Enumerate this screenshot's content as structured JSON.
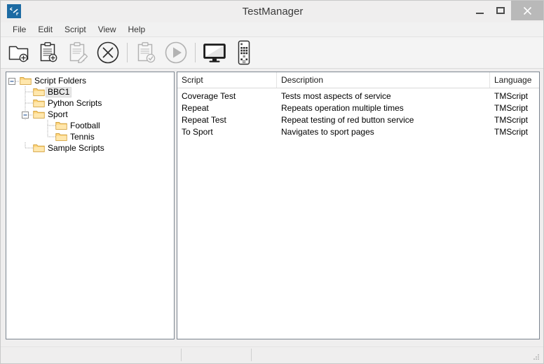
{
  "window": {
    "title": "TestManager",
    "app_icon": "app-icon",
    "controls": {
      "minimize": "minimize-button",
      "maximize": "maximize-button",
      "close": "close-button"
    }
  },
  "menubar": {
    "items": [
      {
        "label": "File"
      },
      {
        "label": "Edit"
      },
      {
        "label": "Script"
      },
      {
        "label": "View"
      },
      {
        "label": "Help"
      }
    ]
  },
  "toolbar": {
    "buttons": [
      {
        "icon": "new-folder-icon",
        "enabled": true
      },
      {
        "icon": "new-script-icon",
        "enabled": true
      },
      {
        "icon": "edit-script-icon",
        "enabled": false
      },
      {
        "icon": "delete-icon",
        "enabled": true
      },
      {
        "separator": true
      },
      {
        "icon": "validate-script-icon",
        "enabled": false
      },
      {
        "icon": "run-script-icon",
        "enabled": false
      },
      {
        "separator": true
      },
      {
        "icon": "television-icon",
        "enabled": true
      },
      {
        "icon": "remote-control-icon",
        "enabled": true
      }
    ]
  },
  "tree": {
    "nodes": [
      {
        "label": "Script Folders",
        "level": 0,
        "expanded": true,
        "selected": false
      },
      {
        "label": "BBC1",
        "level": 1,
        "expanded": null,
        "selected": true
      },
      {
        "label": "Python Scripts",
        "level": 1,
        "expanded": null,
        "selected": false
      },
      {
        "label": "Sport",
        "level": 1,
        "expanded": true,
        "selected": false
      },
      {
        "label": "Football",
        "level": 2,
        "expanded": null,
        "selected": false
      },
      {
        "label": "Tennis",
        "level": 2,
        "expanded": null,
        "selected": false
      },
      {
        "label": "Sample Scripts",
        "level": 1,
        "expanded": null,
        "selected": false
      }
    ]
  },
  "list": {
    "columns": [
      {
        "label": "Script"
      },
      {
        "label": "Description"
      },
      {
        "label": "Language"
      }
    ],
    "rows": [
      {
        "script": "Coverage Test",
        "description": "Tests most aspects of service",
        "language": "TMScript"
      },
      {
        "script": "Repeat",
        "description": "Repeats operation multiple times",
        "language": "TMScript"
      },
      {
        "script": "Repeat Test",
        "description": "Repeat testing of red button service",
        "language": "TMScript"
      },
      {
        "script": "To Sport",
        "description": "Navigates to sport pages",
        "language": "TMScript"
      }
    ]
  },
  "statusbar": {
    "panel1": "",
    "panel2": "",
    "panel3": "",
    "grip": "resize-grip-icon"
  },
  "colors": {
    "window_chrome": "#efeeee",
    "toolbar": "#f4f4f4",
    "pane_border": "#7c8590",
    "folder_fill": "#ffd67e",
    "folder_edge": "#d2a13c",
    "app_icon_blue": "#1d6ba3",
    "close_button": "#b9b9b9",
    "selection": "#e7e7e7"
  }
}
